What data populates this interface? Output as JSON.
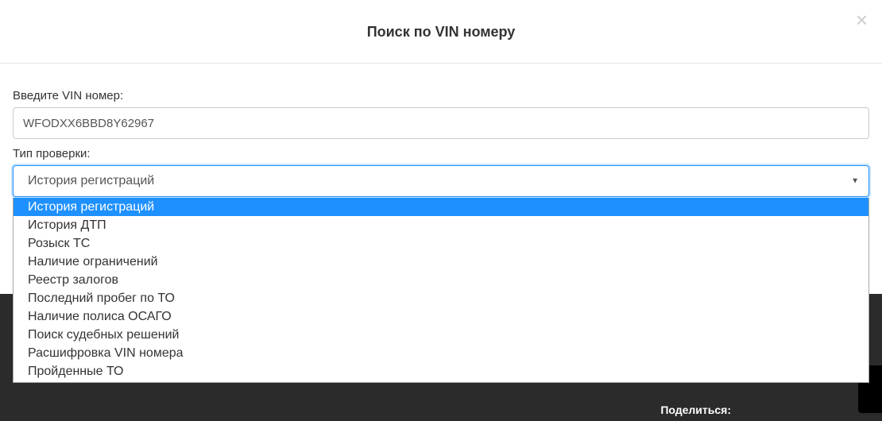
{
  "modal": {
    "title": "Поиск по VIN номеру",
    "close": "×"
  },
  "form": {
    "vin_label": "Введите VIN номер:",
    "vin_value": "WFODXX6BBD8Y62967",
    "check_type_label": "Тип проверки:",
    "check_type_selected": "История регистраций",
    "check_type_options": [
      "История регистраций",
      "История ДТП",
      "Розыск ТС",
      "Наличие ограничений",
      "Реестр залогов",
      "Последний пробег по ТО",
      "Наличие полиса ОСАГО",
      "Поиск судебных решений",
      "Расшифровка VIN номера",
      "Пройденные ТО"
    ]
  },
  "footer": {
    "share_label": "Поделиться:"
  }
}
